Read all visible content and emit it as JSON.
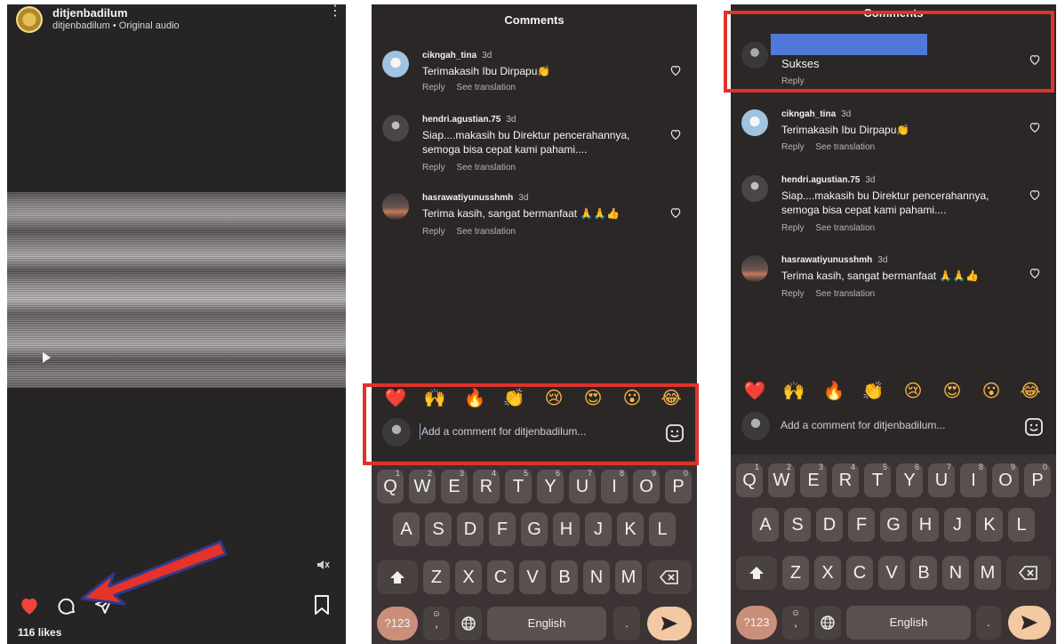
{
  "reel": {
    "username": "ditjenbadilum",
    "audio": "ditjenbadilum • Original audio",
    "likes": "116 likes",
    "accent_heart": "#f0433c",
    "icons": [
      "more-vert-icon",
      "play-icon",
      "volume-off-icon",
      "heart-icon",
      "comment-icon",
      "share-icon",
      "bookmark-icon",
      "red-arrow-annotation"
    ]
  },
  "comments_panel": {
    "title": "Comments",
    "comments": [
      {
        "user": "cikngah_tina",
        "time": "3d",
        "text": "Terimakasih Ibu Dirpapu👏",
        "reply": "Reply",
        "translate": "See translation"
      },
      {
        "user": "hendri.agustian.75",
        "time": "3d",
        "text": "Siap....makasih bu Direktur pencerahannya, semoga bisa cepat kami pahami....",
        "reply": "Reply",
        "translate": "See translation"
      },
      {
        "user": "hasrawatiyunusshmh",
        "time": "3d",
        "text": "Terima kasih, sangat bermanfaat 🙏🙏👍",
        "reply": "Reply",
        "translate": "See translation"
      }
    ],
    "new_comment": {
      "text": "Sukses",
      "reply": "Reply"
    },
    "emojis": [
      "❤️",
      "🙌",
      "🔥",
      "👏",
      "😢",
      "😍",
      "😮",
      "😂"
    ],
    "input_placeholder": "Add a comment for ditjenbadilum..."
  },
  "keyboard": {
    "row1": [
      {
        "k": "Q",
        "n": "1"
      },
      {
        "k": "W",
        "n": "2"
      },
      {
        "k": "E",
        "n": "3"
      },
      {
        "k": "R",
        "n": "4"
      },
      {
        "k": "T",
        "n": "5"
      },
      {
        "k": "Y",
        "n": "6"
      },
      {
        "k": "U",
        "n": "7"
      },
      {
        "k": "I",
        "n": "8"
      },
      {
        "k": "O",
        "n": "9"
      },
      {
        "k": "P",
        "n": "0"
      }
    ],
    "row2": [
      "A",
      "S",
      "D",
      "F",
      "G",
      "H",
      "J",
      "K",
      "L"
    ],
    "row3": [
      "Z",
      "X",
      "C",
      "V",
      "B",
      "N",
      "M"
    ],
    "symbols": "?123",
    "space": "English",
    "period": ".",
    "comma": ",",
    "icons": [
      "shift-icon",
      "backspace-icon",
      "emoji-key-icon",
      "globe-icon",
      "send-icon"
    ]
  },
  "annotation_color": "#e0322a"
}
